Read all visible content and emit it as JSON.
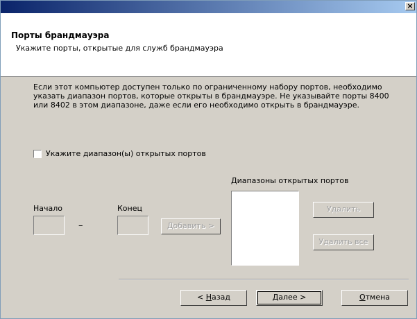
{
  "window": {
    "close_glyph": "×"
  },
  "header": {
    "title": "Порты брандмауэра",
    "subtitle": "Укажите порты, открытые для служб брандмауэра"
  },
  "description": "Если этот компьютер доступен только по ограниченному набору портов, необходимо указать диапазон портов, которые открыты в брандмауэре. Не указывайте порты 8400 или 8402 в этом диапазоне, даже если его необходимо открыть в брандмауэре.",
  "ranges_checkbox": {
    "label": "Укажите диапазон(ы) открытых портов",
    "checked": false
  },
  "port_range": {
    "start_label": "Начало",
    "end_label": "Конец",
    "dash": "–",
    "start_value": "",
    "end_value": "",
    "add_button": "Добавить >"
  },
  "open_ranges": {
    "label": "Диапазоны открытых портов",
    "items": [],
    "delete_button": "Удалить",
    "delete_all_button": "Удалить все"
  },
  "footer": {
    "back_accel": "Н",
    "back_rest": "азад",
    "back_prefix": "< ",
    "next_accel": "Д",
    "next_rest": "алее >",
    "cancel_accel": "О",
    "cancel_rest": "тмена"
  }
}
